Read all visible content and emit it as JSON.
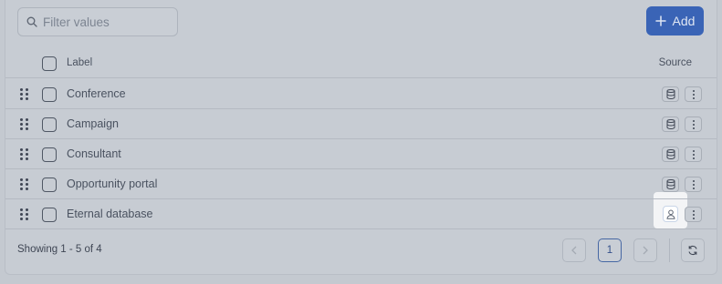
{
  "search": {
    "placeholder": "Filter values",
    "icon": "search-icon"
  },
  "toolbar": {
    "add_label": "Add"
  },
  "table": {
    "columns": {
      "label": "Label",
      "source": "Source"
    },
    "rows": [
      {
        "label": "Conference",
        "source": "database"
      },
      {
        "label": "Campaign",
        "source": "database"
      },
      {
        "label": "Consultant",
        "source": "database"
      },
      {
        "label": "Opportunity portal",
        "source": "database"
      },
      {
        "label": "Eternal database",
        "source": "user"
      }
    ]
  },
  "footer": {
    "showing": "Showing 1 - 5 of 4"
  },
  "pagination": {
    "current_page": "1"
  },
  "colors": {
    "accent": "#3a64b6",
    "overlay": "#c7ccd3"
  }
}
